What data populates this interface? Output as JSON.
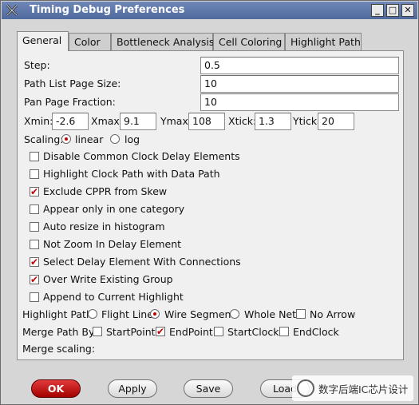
{
  "window": {
    "title": "Timing Debug Preferences"
  },
  "titlebar_buttons": [
    "_",
    "□",
    "✕"
  ],
  "tabs": [
    "General",
    "Color",
    "Bottleneck Analysis",
    "Cell Coloring",
    "Highlight Path"
  ],
  "fields": {
    "step": {
      "label": "Step:",
      "value": "0.5"
    },
    "page_size": {
      "label": "Path List Page Size:",
      "value": "10"
    },
    "pan_fraction": {
      "label": "Pan Page Fraction:",
      "value": "10"
    }
  },
  "axes": {
    "xmin": {
      "label": "Xmin:",
      "value": "-2.6"
    },
    "xmax": {
      "label": "Xmax:",
      "value": "9.1"
    },
    "ymax": {
      "label": "Ymax:",
      "value": "108"
    },
    "xtick": {
      "label": "Xtick:",
      "value": "1.3"
    },
    "ytick": {
      "label": "Ytick:",
      "value": "20"
    }
  },
  "scaling": {
    "label": "Scaling:",
    "linear": "linear",
    "log": "log",
    "selected": "linear"
  },
  "options": [
    {
      "label": "Disable Common Clock Delay Elements",
      "checked": false
    },
    {
      "label": "Highlight Clock Path with Data Path",
      "checked": false
    },
    {
      "label": "Exclude CPPR from Skew",
      "checked": true
    },
    {
      "label": "Appear only in one category",
      "checked": false
    },
    {
      "label": "Auto resize in histogram",
      "checked": false
    },
    {
      "label": "Not Zoom In Delay Element",
      "checked": false
    },
    {
      "label": "Select Delay Element With Connections",
      "checked": true
    },
    {
      "label": "Over Write Existing Group",
      "checked": true
    },
    {
      "label": "Append to Current Highlight",
      "checked": false
    }
  ],
  "highlight_path": {
    "label": "Highlight Path:",
    "flight_line": "Flight Line",
    "wire_segment": "Wire Segment",
    "whole_net": "Whole Net",
    "no_arrow": "No Arrow",
    "selected": "Wire Segment",
    "no_arrow_checked": false
  },
  "merge_path": {
    "label": "Merge Path By:",
    "start_point": {
      "label": "StartPoint",
      "checked": false
    },
    "end_point": {
      "label": "EndPoint",
      "checked": true
    },
    "start_clock": {
      "label": "StartClock",
      "checked": false
    },
    "end_clock": {
      "label": "EndClock",
      "checked": false
    }
  },
  "merge_scaling": {
    "label": "Merge scaling:"
  },
  "buttons": {
    "ok": "OK",
    "apply": "Apply",
    "save": "Save",
    "load": "Load"
  },
  "watermark": {
    "text": "数字后端IC芯片设计"
  },
  "colors": {
    "accent": "#c00000",
    "titlebar": "#5b76a8",
    "panel": "#f0f0f0"
  }
}
